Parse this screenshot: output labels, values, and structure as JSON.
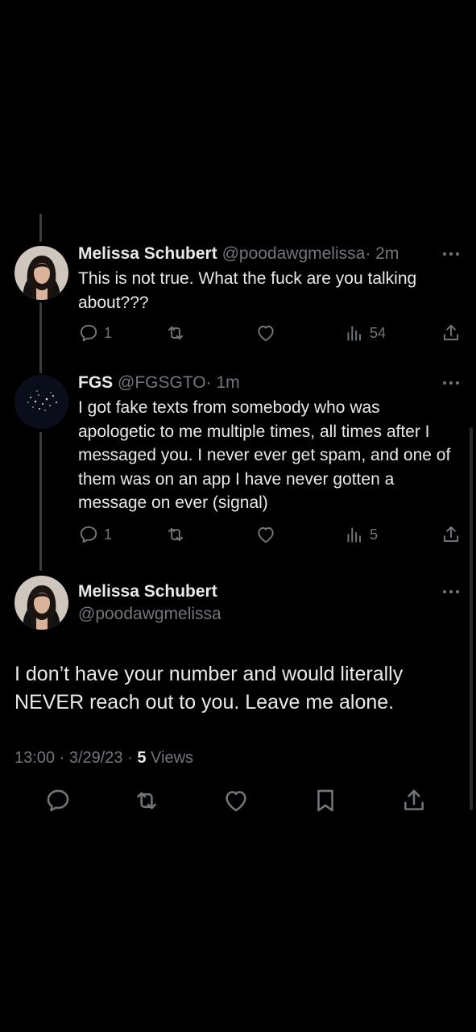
{
  "thread": [
    {
      "name": "Melissa Schubert",
      "handle": "@poodawgmelissa",
      "time": "· 2m",
      "text": "This is not true. What the fuck are you talking about???",
      "replies": "1",
      "retweets": "",
      "likes": "",
      "views": "54"
    },
    {
      "name": "FGS",
      "handle": "@FGSGTO",
      "time": "· 1m",
      "text": "I got fake texts from somebody who was apologetic to me multiple times, all times after I messaged you. I never ever get spam, and one of them was on an app I have never gotten a message on ever (signal)",
      "replies": "1",
      "retweets": "",
      "likes": "",
      "views": "5"
    }
  ],
  "main": {
    "name": "Melissa Schubert",
    "handle": "@poodawgmelissa",
    "text": "I don’t have your number and would literally NEVER reach out to you. Leave me alone.",
    "time": "13:00 · 3/29/23 ·",
    "views_count": "5",
    "views_label": "Views"
  },
  "icons": {
    "reply": "reply-icon",
    "retweet": "retweet-icon",
    "like": "heart-icon",
    "views": "views-icon",
    "share": "share-icon",
    "bookmark": "bookmark-icon",
    "more": "more-icon"
  },
  "colors": {
    "background": "#000000",
    "text": "#e7e9ea",
    "muted": "#71767b",
    "thread_line": "#3a3d40"
  }
}
